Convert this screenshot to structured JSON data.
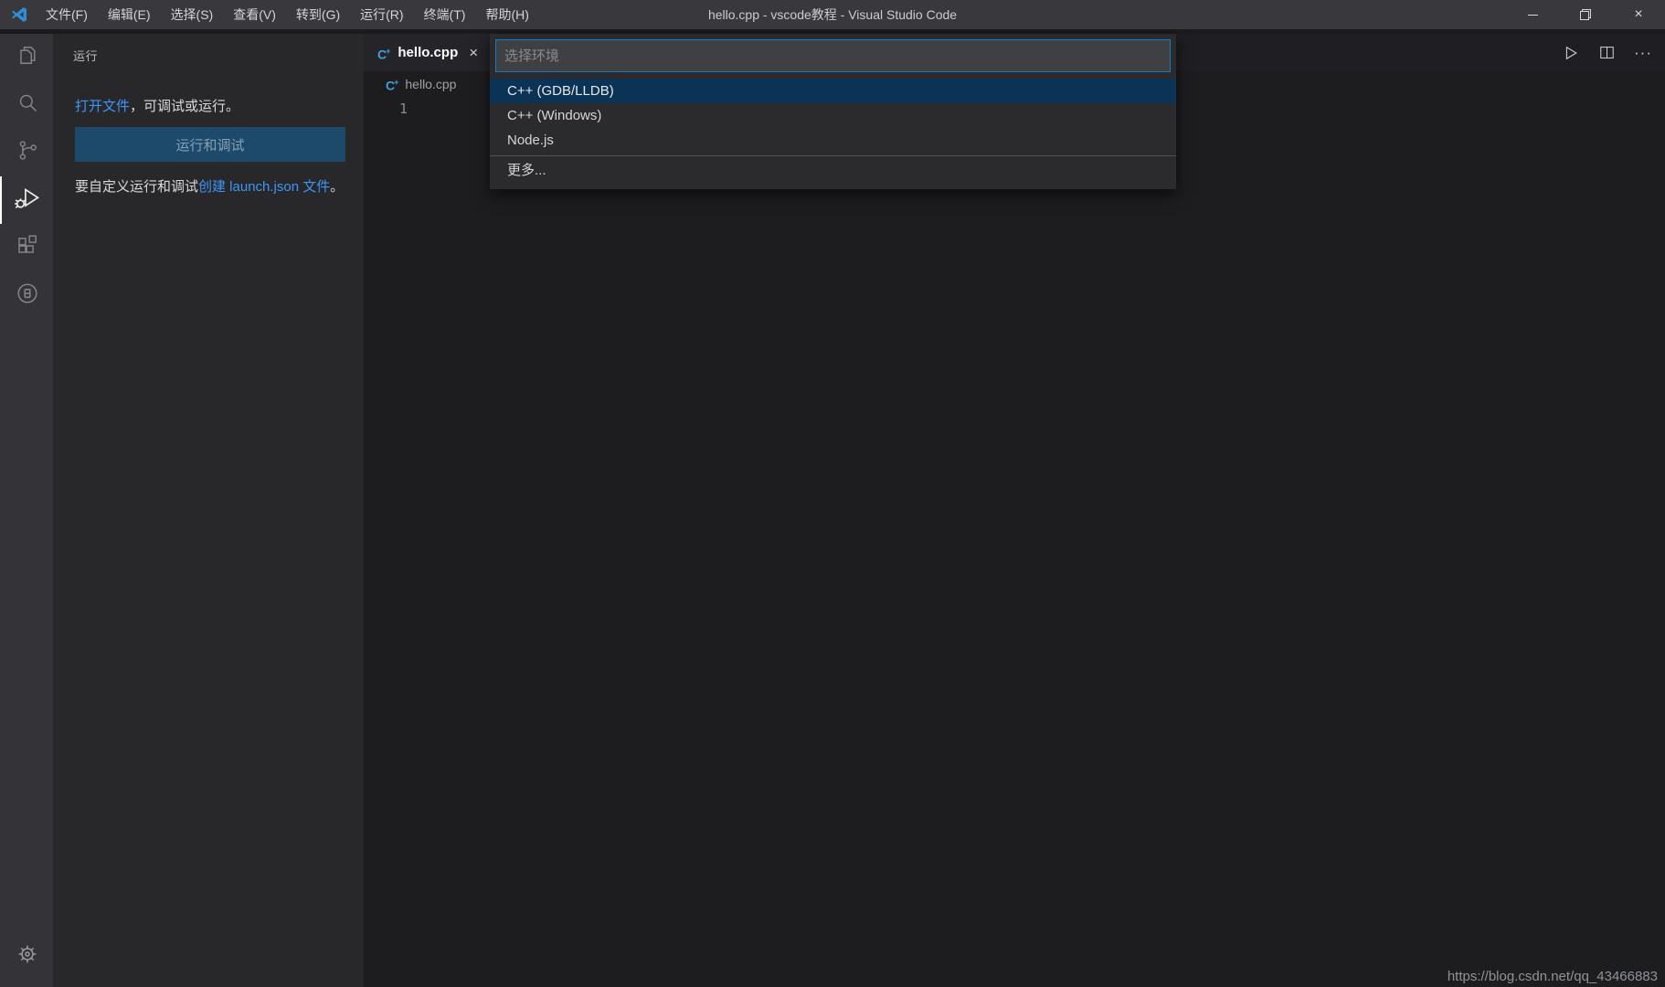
{
  "window": {
    "title": "hello.cpp - vscode教程 - Visual Studio Code"
  },
  "menu": {
    "items": [
      "文件(F)",
      "编辑(E)",
      "选择(S)",
      "查看(V)",
      "转到(G)",
      "运行(R)",
      "终端(T)",
      "帮助(H)"
    ]
  },
  "activity_bar": {
    "items": [
      {
        "name": "explorer"
      },
      {
        "name": "search"
      },
      {
        "name": "source-control"
      },
      {
        "name": "run-and-debug",
        "active": true
      },
      {
        "name": "extensions"
      },
      {
        "name": "language-pack-extension"
      }
    ],
    "bottom": [
      {
        "name": "manage-settings"
      }
    ]
  },
  "sidebar": {
    "title": "运行",
    "welcome": {
      "open_file_link": "打开文件",
      "open_file_rest": "，可调试或运行。",
      "run_button": "运行和调试",
      "customize_text": "要自定义运行和调试",
      "customize_link": "创建 launch.json 文件",
      "customize_end": "。"
    }
  },
  "editor": {
    "tab": {
      "label": "hello.cpp"
    },
    "breadcrumb": "hello.cpp",
    "line_number": "1"
  },
  "quick_pick": {
    "placeholder": "选择环境",
    "selected_index": 0,
    "items": [
      {
        "label": "C++ (GDB/LLDB)"
      },
      {
        "label": "C++ (Windows)"
      },
      {
        "label": "Node.js"
      },
      {
        "label": "更多...",
        "separator_above": true
      }
    ]
  },
  "icons": {
    "tab_close": "×",
    "window_close": "×",
    "more_actions": "···",
    "cpp_letter": "C",
    "cpp_plus": "+"
  },
  "colors": {
    "focus_border": "#157bc4",
    "selected_item_bg": "#0b3356",
    "link": "#3d96f7",
    "button_bg": "#1d4a6b",
    "cpp_icon_blue": "#41a0dc",
    "logo_blue": "#2f8fd5"
  },
  "watermark": "https://blog.csdn.net/qq_43466883"
}
